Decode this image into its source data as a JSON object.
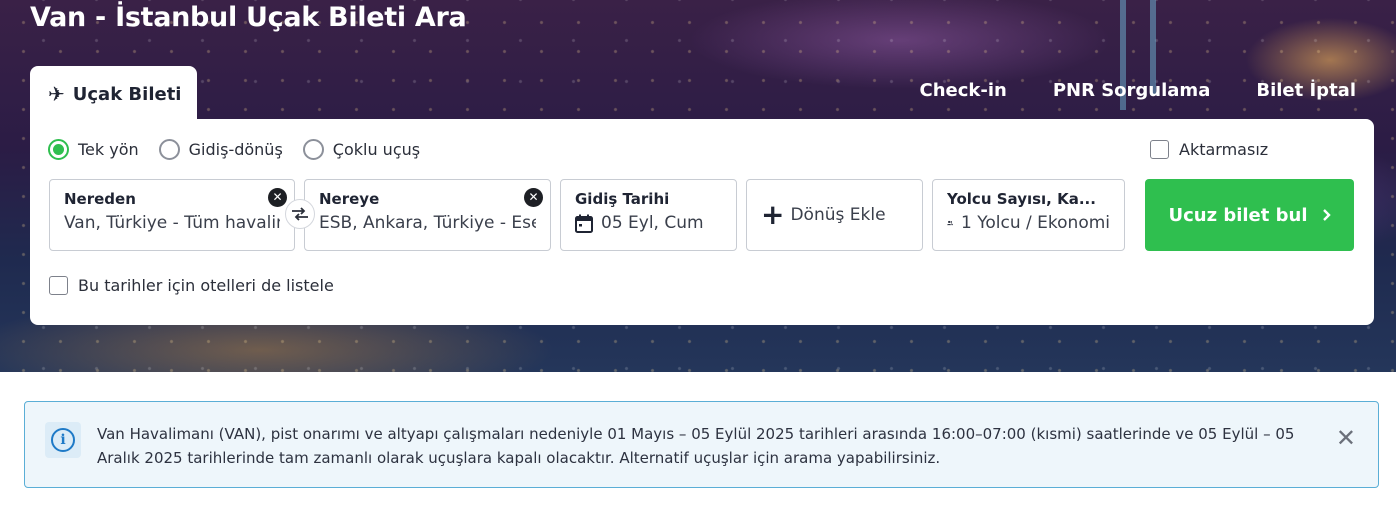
{
  "page": {
    "title": "Van - İstanbul Uçak Bileti Ara"
  },
  "tabs": {
    "active": {
      "label": "Uçak Bileti",
      "icon": "airplane-icon"
    },
    "links": [
      {
        "label": "Check-in"
      },
      {
        "label": "PNR Sorgulama"
      },
      {
        "label": "Bilet İptal"
      }
    ]
  },
  "trip_types": [
    {
      "label": "Tek yön",
      "checked": true
    },
    {
      "label": "Gidiş-dönüş",
      "checked": false
    },
    {
      "label": "Çoklu uçuş",
      "checked": false
    }
  ],
  "nonstop": {
    "label": "Aktarmasız",
    "checked": false
  },
  "from": {
    "label": "Nereden",
    "value": "Van, Türkiye - Tüm havalimanları"
  },
  "to": {
    "label": "Nereye",
    "value": "ESB, Ankara, Türkiye - Esenboğa"
  },
  "departure": {
    "label": "Gidiş Tarihi",
    "value": "05 Eyl, Cum",
    "icon": "calendar-icon"
  },
  "return": {
    "label": "Dönüş Ekle",
    "icon": "plus-icon"
  },
  "passengers": {
    "label": "Yolcu Sayısı, Ka...",
    "value": "1 Yolcu / Ekonomi",
    "icon": "users-icon"
  },
  "search_button": {
    "label": "Ucuz bilet bul",
    "icon": "chevron-right-icon"
  },
  "hotels": {
    "label": "Bu tarihler için otelleri de listele",
    "checked": false
  },
  "notice": {
    "text": "Van Havalimanı (VAN), pist onarımı ve altyapı çalışmaları nedeniyle 01 Mayıs – 05 Eylül 2025 tarihleri arasında 16:00–07:00 (kısmi) saatlerinde ve 05 Eylül – 05 Aralık 2025 tarihlerinde tam zamanlı olarak uçuşlara kapalı olacaktır. Alternatif uçuşlar için arama yapabilirsiniz.",
    "icon": "info-icon",
    "close_icon": "close-icon"
  },
  "colors": {
    "accent_green": "#2fbf4f",
    "info_blue": "#1e7ac7",
    "notice_border": "#5aaed6",
    "notice_bg": "#eef6fb"
  }
}
